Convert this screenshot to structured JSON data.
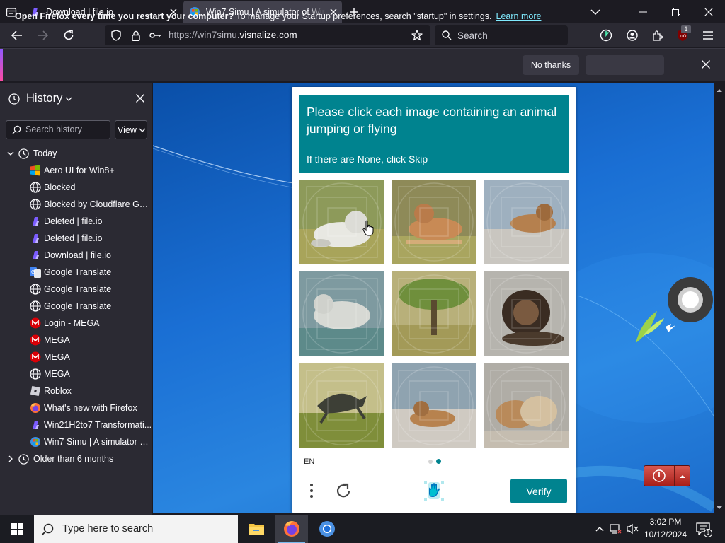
{
  "browser": {
    "tabs": [
      {
        "title": "Download | file.io",
        "active": false
      },
      {
        "title": "Win7 Simu | A simulator of Windows",
        "active": true
      }
    ],
    "url_prefix": "https://win7simu.",
    "url_domain": "visnalize.com",
    "search_placeholder": "Search",
    "extension_badge": "1"
  },
  "notification": {
    "message_bold": "Open Firefox every time you restart your computer?",
    "message": "To manage your Startup preferences, search \"startup\" in settings.",
    "link": "Learn more",
    "button": "No thanks"
  },
  "sidebar": {
    "title": "History",
    "search_placeholder": "Search history",
    "view_button": "View",
    "group_today": "Today",
    "items": [
      {
        "label": "Aero UI for Win8+",
        "icon": "windows-logo-icon"
      },
      {
        "label": "Blocked",
        "icon": "globe-icon"
      },
      {
        "label": "Blocked by Cloudflare Gat...",
        "icon": "globe-icon"
      },
      {
        "label": "Deleted | file.io",
        "icon": "fileio-icon"
      },
      {
        "label": "Deleted | file.io",
        "icon": "fileio-icon"
      },
      {
        "label": "Download | file.io",
        "icon": "fileio-icon"
      },
      {
        "label": "Google Translate",
        "icon": "google-translate-icon"
      },
      {
        "label": "Google Translate",
        "icon": "globe-icon"
      },
      {
        "label": "Google Translate",
        "icon": "globe-icon"
      },
      {
        "label": "Login - MEGA",
        "icon": "mega-icon"
      },
      {
        "label": "MEGA",
        "icon": "mega-icon"
      },
      {
        "label": "MEGA",
        "icon": "mega-icon"
      },
      {
        "label": "MEGA",
        "icon": "globe-icon"
      },
      {
        "label": "Roblox",
        "icon": "roblox-icon"
      },
      {
        "label": "What's new with Firefox",
        "icon": "firefox-icon"
      },
      {
        "label": "Win21H2to7 Transformati...",
        "icon": "fileio-icon"
      },
      {
        "label": "Win7 Simu | A simulator of...",
        "icon": "win7simu-icon"
      }
    ],
    "group_older": "Older than 6 months"
  },
  "captcha": {
    "prompt": "Please click each image containing an animal jumping or flying",
    "skip_hint": "If there are None, click Skip",
    "language": "EN",
    "verify_button": "Verify",
    "tiles": [
      {
        "subject": "white lion lying in grass"
      },
      {
        "subject": "lion lying on grass"
      },
      {
        "subject": "lion lying on rocks"
      },
      {
        "subject": "white lion lying by water"
      },
      {
        "subject": "tree on savanna"
      },
      {
        "subject": "dark lion lying"
      },
      {
        "subject": "animal leaping over grass"
      },
      {
        "subject": "lion lying on rocks"
      },
      {
        "subject": "two lions lying"
      }
    ]
  },
  "taskbar": {
    "search_placeholder": "Type here to search",
    "time": "3:02 PM",
    "date": "10/12/2024"
  },
  "colors": {
    "captcha_teal": "#00838f",
    "firefox_dark": "#1c1b22",
    "firefox_toolbar": "#2b2a33"
  }
}
